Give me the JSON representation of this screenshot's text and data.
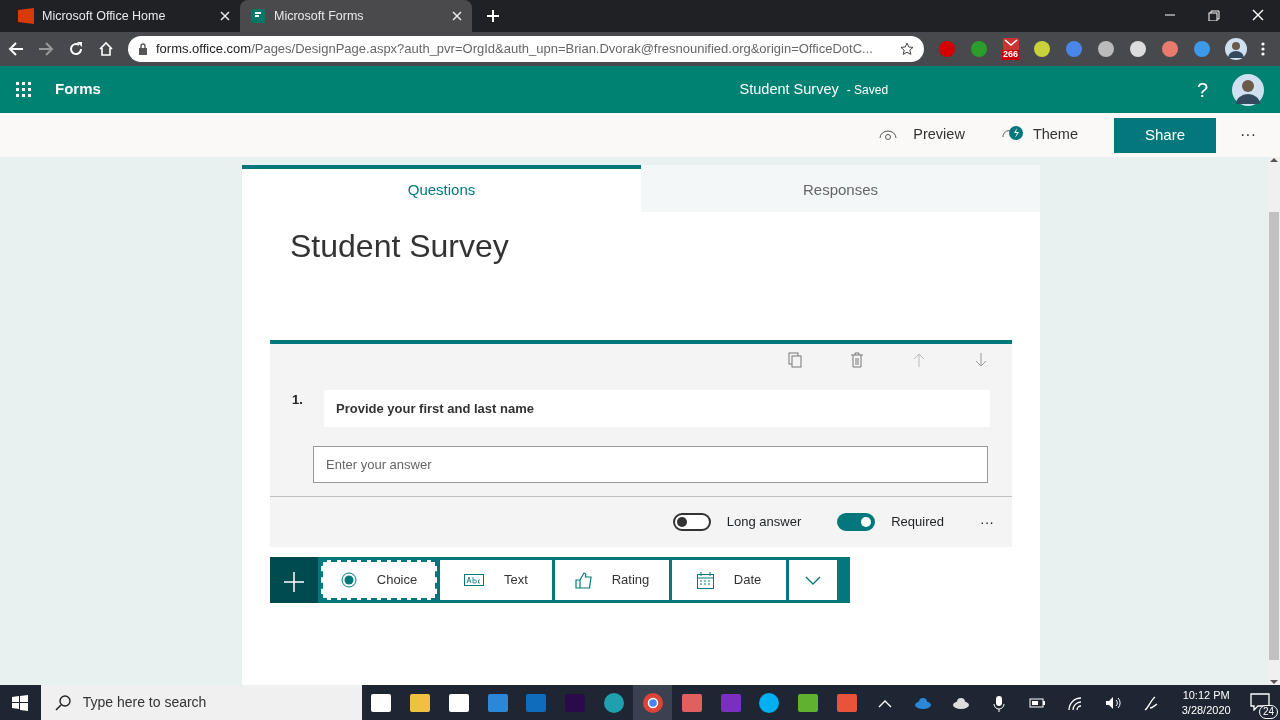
{
  "browser": {
    "tabs": [
      {
        "title": "Microsoft Office Home",
        "selected": false,
        "kind": "office"
      },
      {
        "title": "Microsoft Forms",
        "selected": true,
        "kind": "forms"
      }
    ],
    "url_domain": "forms.office.com",
    "url_path": "/Pages/DesignPage.aspx?auth_pvr=OrgId&auth_upn=Brian.Dvorak@fresnounified.org&origin=OfficeDotC...",
    "extension_badge": "266"
  },
  "app_bar": {
    "app_name": "Forms",
    "form_name": "Student Survey",
    "save_status": "- Saved",
    "help": "?"
  },
  "toolbar": {
    "preview": "Preview",
    "theme": "Theme",
    "share": "Share",
    "more": "···"
  },
  "form_tabs": [
    {
      "label": "Questions",
      "selected": true
    },
    {
      "label": "Responses",
      "selected": false
    }
  ],
  "form_title": "Student Survey",
  "question": {
    "number": "1.",
    "text": "Provide your first and last name",
    "placeholder": "Enter your answer",
    "more": "···",
    "toggles": [
      {
        "label": "Long answer",
        "on": false
      },
      {
        "label": "Required",
        "on": true
      }
    ]
  },
  "add_options": [
    {
      "label": "Choice",
      "kind": "choice",
      "selected": true
    },
    {
      "label": "Text",
      "kind": "text",
      "selected": false
    },
    {
      "label": "Rating",
      "kind": "rating",
      "selected": false
    },
    {
      "label": "Date",
      "kind": "date",
      "selected": false
    }
  ],
  "taskbar": {
    "search_placeholder": "Type here to search",
    "time": "10:12 PM",
    "date": "3/28/2020",
    "notifications": "24"
  }
}
